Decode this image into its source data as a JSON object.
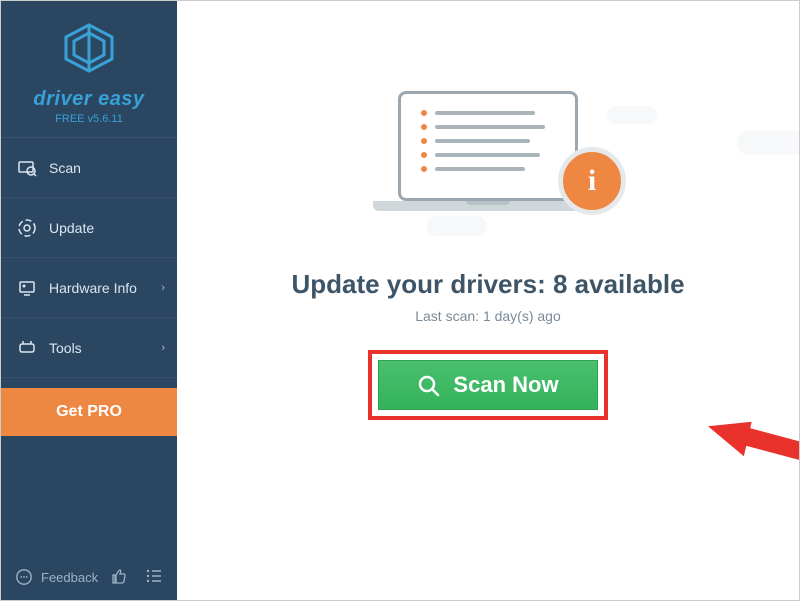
{
  "brand": {
    "name": "driver easy",
    "version_line": "FREE v5.6.11"
  },
  "sidebar": {
    "items": [
      {
        "label": "Scan",
        "icon": "scan-icon",
        "expandable": false
      },
      {
        "label": "Update",
        "icon": "update-icon",
        "expandable": false
      },
      {
        "label": "Hardware Info",
        "icon": "hardware-icon",
        "expandable": true
      },
      {
        "label": "Tools",
        "icon": "tools-icon",
        "expandable": true
      }
    ],
    "get_pro_label": "Get PRO",
    "feedback_label": "Feedback"
  },
  "main": {
    "headline_prefix": "Update your drivers: ",
    "available_count": "8",
    "headline_suffix": " available",
    "last_scan": "Last scan: 1 day(s) ago",
    "scan_button": "Scan Now",
    "info_badge": "i"
  },
  "window": {
    "minimize": "—",
    "close": "✕"
  }
}
